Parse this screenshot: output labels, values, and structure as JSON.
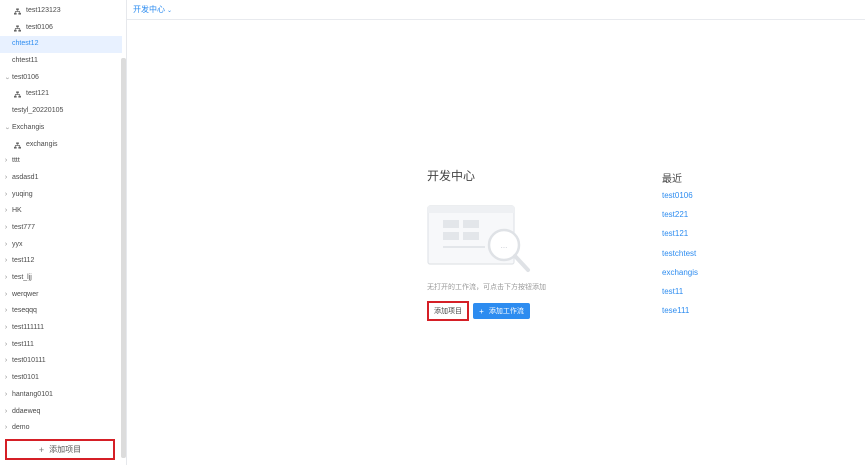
{
  "header": {
    "title": "开发中心"
  },
  "sidebar": {
    "items": [
      {
        "label": "test123123",
        "type": "workflow",
        "level": 1
      },
      {
        "label": "test0106",
        "type": "workflow",
        "level": 1
      },
      {
        "label": "chtest12",
        "type": "project",
        "level": 0,
        "selected": true
      },
      {
        "label": "chtest11",
        "type": "project",
        "level": 0
      },
      {
        "label": "test0106",
        "type": "project",
        "level": 0,
        "expanded": true
      },
      {
        "label": "test121",
        "type": "workflow",
        "level": 1
      },
      {
        "label": "testyl_20220105",
        "type": "project",
        "level": 0
      },
      {
        "label": "Exchangis",
        "type": "project",
        "level": 0,
        "expanded": true
      },
      {
        "label": "exchangis",
        "type": "workflow",
        "level": 1
      },
      {
        "label": "tttt",
        "type": "project",
        "level": 0,
        "collapsed": true
      },
      {
        "label": "asdasd1",
        "type": "project",
        "level": 0,
        "collapsed": true
      },
      {
        "label": "yuqing",
        "type": "project",
        "level": 0,
        "collapsed": true
      },
      {
        "label": "HK",
        "type": "project",
        "level": 0,
        "collapsed": true
      },
      {
        "label": "test777",
        "type": "project",
        "level": 0,
        "collapsed": true
      },
      {
        "label": "yyx",
        "type": "project",
        "level": 0,
        "collapsed": true
      },
      {
        "label": "test112",
        "type": "project",
        "level": 0,
        "collapsed": true
      },
      {
        "label": "test_ljj",
        "type": "project",
        "level": 0,
        "collapsed": true
      },
      {
        "label": "werqwer",
        "type": "project",
        "level": 0,
        "collapsed": true
      },
      {
        "label": "teseqqq",
        "type": "project",
        "level": 0,
        "collapsed": true
      },
      {
        "label": "test111111",
        "type": "project",
        "level": 0,
        "collapsed": true
      },
      {
        "label": "test111",
        "type": "project",
        "level": 0,
        "collapsed": true
      },
      {
        "label": "test010111",
        "type": "project",
        "level": 0,
        "collapsed": true
      },
      {
        "label": "test0101",
        "type": "project",
        "level": 0,
        "collapsed": true
      },
      {
        "label": "hantang0101",
        "type": "project",
        "level": 0,
        "collapsed": true
      },
      {
        "label": "ddaeweq",
        "type": "project",
        "level": 0,
        "collapsed": true
      },
      {
        "label": "demo",
        "type": "project",
        "level": 0,
        "collapsed": true
      }
    ],
    "add_project_label": "添加项目",
    "add_icon": "plus-icon"
  },
  "main": {
    "title": "开发中心",
    "empty_text": "无打开的工作流，可点击下方按钮添加",
    "add_project_label": "添加项目",
    "add_workflow_label": "添加工作流",
    "recent": {
      "title": "最近",
      "items": [
        "test0106",
        "test221",
        "test121",
        "testchtest",
        "exchangis",
        "test11",
        "tese111"
      ]
    }
  },
  "colors": {
    "accent": "#2d8cf0",
    "highlight_border": "#d51f26",
    "selected_bg": "#e8f1ff"
  }
}
